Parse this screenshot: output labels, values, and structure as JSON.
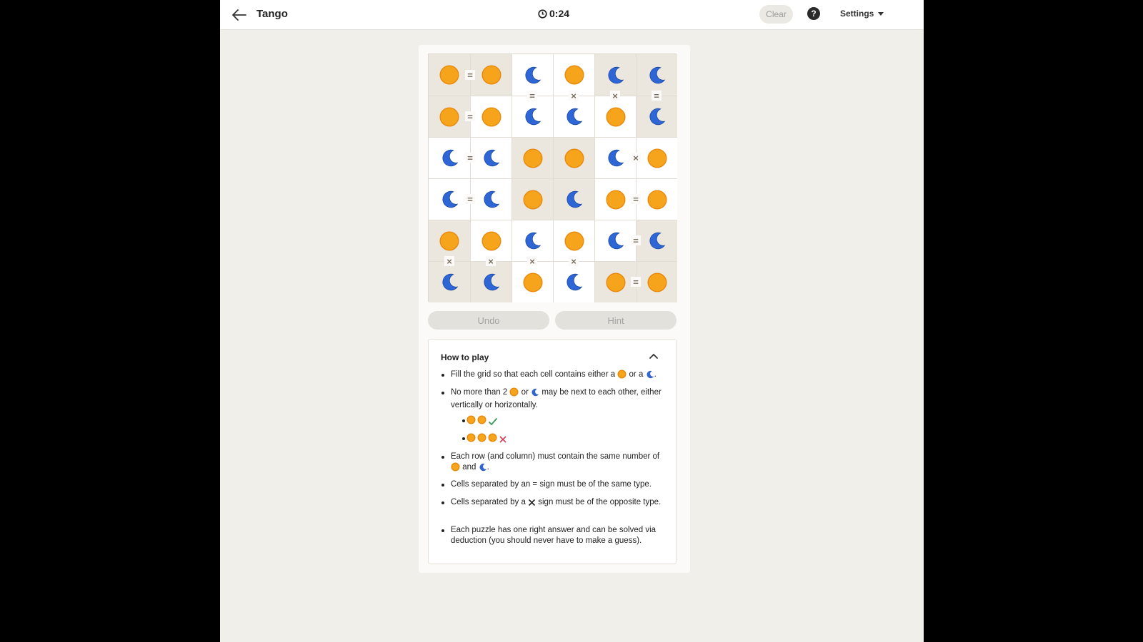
{
  "header": {
    "title": "Tango",
    "timer": "0:24",
    "clear_label": "Clear",
    "help_label": "?",
    "settings_label": "Settings"
  },
  "board": {
    "rows": [
      [
        "sun",
        "sun",
        "moon",
        "sun",
        "moon",
        "moon"
      ],
      [
        "sun",
        "sun",
        "moon",
        "moon",
        "sun",
        "moon"
      ],
      [
        "moon",
        "moon",
        "sun",
        "sun",
        "moon",
        "sun"
      ],
      [
        "moon",
        "moon",
        "sun",
        "moon",
        "sun",
        "sun"
      ],
      [
        "sun",
        "sun",
        "moon",
        "sun",
        "moon",
        "moon"
      ],
      [
        "moon",
        "moon",
        "sun",
        "moon",
        "sun",
        "sun"
      ]
    ],
    "prefilled": [
      [
        true,
        true,
        false,
        false,
        true,
        true
      ],
      [
        true,
        false,
        false,
        false,
        false,
        true
      ],
      [
        false,
        false,
        true,
        true,
        false,
        false
      ],
      [
        false,
        false,
        true,
        true,
        false,
        false
      ],
      [
        true,
        false,
        false,
        false,
        false,
        true
      ],
      [
        true,
        true,
        false,
        false,
        true,
        true
      ]
    ],
    "constraints": [
      {
        "r": 0,
        "c": 0,
        "dir": "h",
        "sign": "="
      },
      {
        "r": 0,
        "c": 2,
        "dir": "v",
        "sign": "="
      },
      {
        "r": 0,
        "c": 3,
        "dir": "v",
        "sign": "×"
      },
      {
        "r": 0,
        "c": 4,
        "dir": "v",
        "sign": "×"
      },
      {
        "r": 0,
        "c": 5,
        "dir": "v",
        "sign": "="
      },
      {
        "r": 1,
        "c": 0,
        "dir": "h",
        "sign": "="
      },
      {
        "r": 2,
        "c": 0,
        "dir": "h",
        "sign": "="
      },
      {
        "r": 2,
        "c": 4,
        "dir": "h",
        "sign": "×"
      },
      {
        "r": 3,
        "c": 0,
        "dir": "h",
        "sign": "="
      },
      {
        "r": 3,
        "c": 4,
        "dir": "h",
        "sign": "="
      },
      {
        "r": 4,
        "c": 4,
        "dir": "h",
        "sign": "="
      },
      {
        "r": 4,
        "c": 0,
        "dir": "v",
        "sign": "×"
      },
      {
        "r": 4,
        "c": 1,
        "dir": "v",
        "sign": "×"
      },
      {
        "r": 4,
        "c": 2,
        "dir": "v",
        "sign": "×"
      },
      {
        "r": 4,
        "c": 3,
        "dir": "v",
        "sign": "×"
      },
      {
        "r": 5,
        "c": 4,
        "dir": "h",
        "sign": "="
      }
    ]
  },
  "actions": {
    "undo_label": "Undo",
    "hint_label": "Hint"
  },
  "how_to_play": {
    "title": "How to play",
    "rule1_a": "Fill the grid so that each cell contains either a",
    "rule1_b": "or a",
    "rule1_c": ".",
    "rule2_a": "No more than 2",
    "rule2_b": "or",
    "rule2_c": "may be next to each other, either vertically or horizontally.",
    "rule3_a": "Each row (and column) must contain the same number of",
    "rule3_b": "and",
    "rule3_c": ".",
    "rule4": "Cells separated by an = sign must be of the same type.",
    "rule5_a": "Cells separated by a",
    "rule5_b": "sign must be of the opposite type.",
    "rule6": "Each puzzle has one right answer and can be solved via deduction (you should never have to make a guess)."
  },
  "colors": {
    "sun": "#f7a41d",
    "sun_stroke": "#e8890c",
    "moon": "#2f66d6",
    "valid": "#3a9a5b",
    "invalid": "#d0455e"
  },
  "icons": [
    "back-arrow-icon",
    "clock-icon",
    "help-icon",
    "chevron-down-icon",
    "chevron-up-icon",
    "sun-icon",
    "moon-icon",
    "check-icon",
    "cross-icon"
  ]
}
